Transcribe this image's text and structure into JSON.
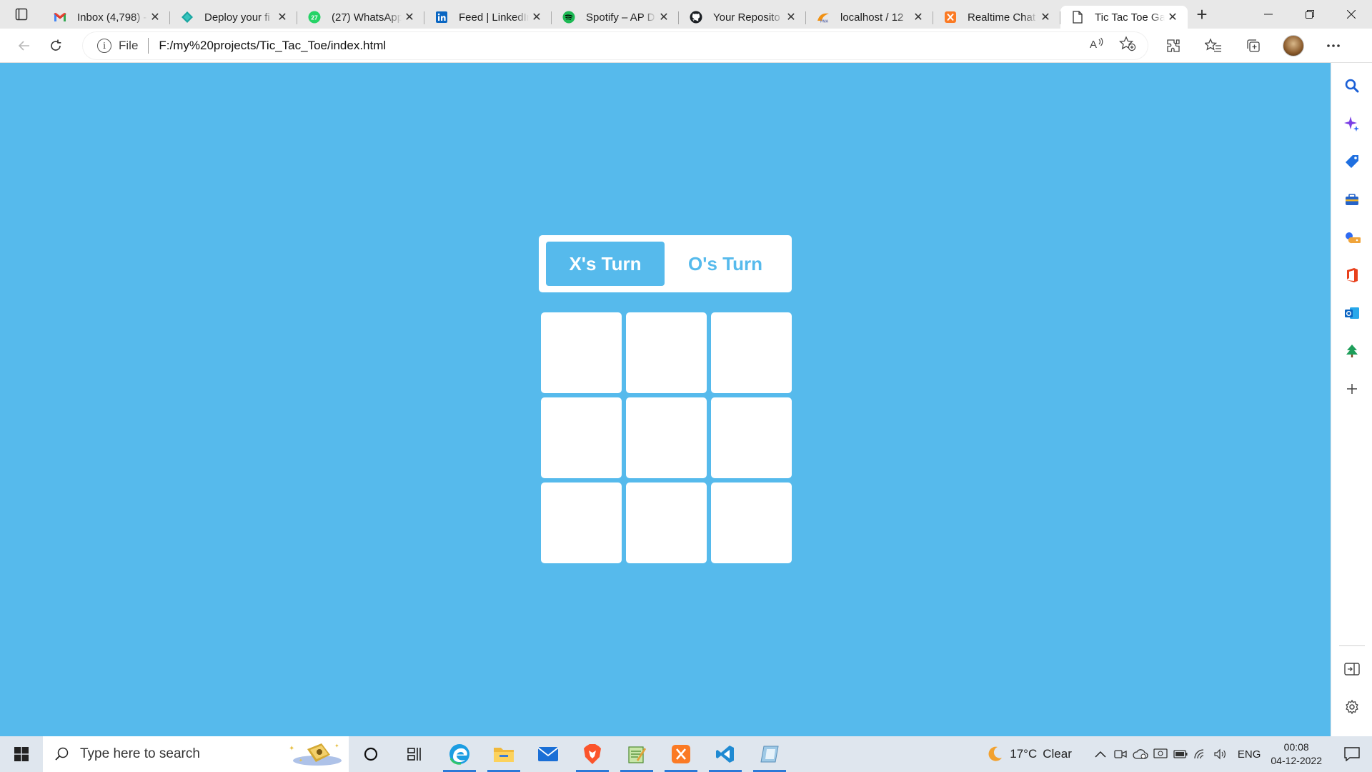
{
  "browser": {
    "tabs": [
      {
        "title": "Inbox (4,798) - ",
        "icon": "gmail-icon",
        "active": false
      },
      {
        "title": "Deploy your fi",
        "icon": "deploy-icon",
        "active": false
      },
      {
        "title": "(27) WhatsApp",
        "icon": "whatsapp-icon",
        "badge": "27",
        "active": false
      },
      {
        "title": "Feed | LinkedIn",
        "icon": "linkedin-icon",
        "active": false
      },
      {
        "title": "Spotify – AP D",
        "icon": "spotify-icon",
        "active": false
      },
      {
        "title": "Your Reposito",
        "icon": "github-icon",
        "active": false
      },
      {
        "title": "localhost / 12",
        "icon": "phpmyadmin-icon",
        "active": false
      },
      {
        "title": "Realtime Chat",
        "icon": "xampp-icon",
        "active": false
      },
      {
        "title": "Tic Tac Toe Ga",
        "icon": "page-icon",
        "active": true
      }
    ],
    "address": {
      "scheme_label": "File",
      "url": "F:/my%20projects/Tic_Tac_Toe/index.html"
    }
  },
  "game": {
    "x_turn_label": "X's Turn",
    "o_turn_label": "O's Turn",
    "current_turn": "X",
    "board": [
      "",
      "",
      "",
      "",
      "",
      "",
      "",
      "",
      ""
    ]
  },
  "colors": {
    "page_background": "#56baec",
    "accent": "#56baec",
    "cell": "#ffffff"
  },
  "sidebar": {
    "icons": [
      "search-icon",
      "sparkle-icon",
      "shopping-tag-icon",
      "tools-icon",
      "games-icon",
      "office-icon",
      "outlook-icon",
      "tree-icon",
      "add-icon"
    ],
    "bottom_icons": [
      "split-screen-icon",
      "settings-icon"
    ]
  },
  "taskbar": {
    "search_placeholder": "Type here to search",
    "apps": [
      "cortana-icon",
      "task-view-icon",
      "edge-icon",
      "file-explorer-icon",
      "mail-icon",
      "brave-icon",
      "notepad-icon",
      "xampp-icon",
      "vscode-icon",
      "unknown-app-icon"
    ],
    "weather": {
      "temp": "17°C",
      "condition": "Clear"
    },
    "language": "ENG",
    "time": "00:08",
    "date": "04-12-2022"
  }
}
